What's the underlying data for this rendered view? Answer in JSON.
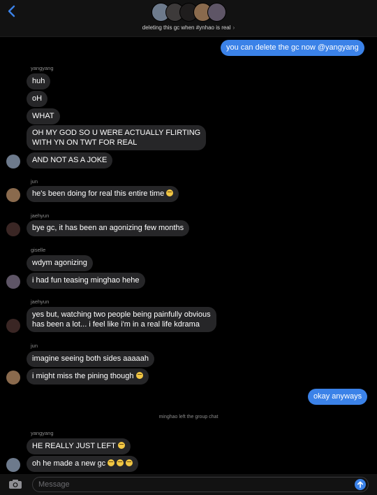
{
  "header": {
    "back_icon": "chevron-left-icon",
    "group_title": "deleting this gc when #ynhao is real",
    "title_chevron": "›",
    "accent": "#3b82e8"
  },
  "messages": {
    "m1": "you can delete the gc now @yangyang",
    "s1": "yangyang",
    "m2": "huh",
    "m3": "oH",
    "m4": "WHAT",
    "m5a": "OH MY GOD SO U WERE ACTUALLY FLIRTING",
    "m5b": "WITH YN ON TWT FOR REAL",
    "m6": "AND NOT AS A JOKE",
    "s2": "jun",
    "m7": "he's been doing for real this entire time",
    "s3": "jaehyun",
    "m8": "bye gc, it has been an agonizing few months",
    "s4": "giselle",
    "m9": "wdym agonizing",
    "m10": "i had fun teasing minghao hehe",
    "s5": "jaehyun",
    "m11a": "yes but, watching two people being painfully obvious",
    "m11b": "has been a lot... i feel like i'm in a real life kdrama",
    "s6": "jun",
    "m12": "imagine seeing both sides aaaaah",
    "m13": "i might miss the pining though",
    "m14": "okay anyways",
    "system": "minghao left the group chat",
    "s7": "yangyang",
    "m15": "HE REALLY JUST LEFT",
    "m16": "oh he made a new gc"
  },
  "composer": {
    "placeholder": "Message",
    "camera_icon": "camera-icon",
    "send_icon": "send-arrow-icon"
  }
}
